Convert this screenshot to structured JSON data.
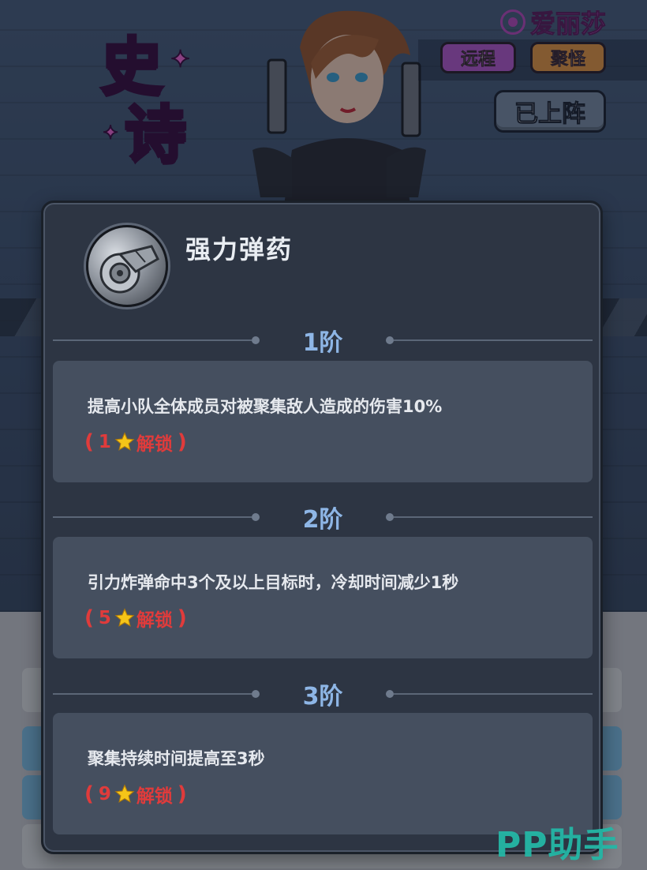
{
  "hero": {
    "rarity_char_1": "史",
    "rarity_char_2": "诗",
    "name": "爱丽莎",
    "tags": [
      "远程",
      "聚怪"
    ],
    "deployed_label": "已上阵"
  },
  "skill": {
    "title": "强力弹药",
    "tiers": [
      {
        "label": "1阶",
        "desc": "提高小队全体成员对被聚集敌人造成的伤害10%",
        "stars": "1",
        "unlock_label": "解锁"
      },
      {
        "label": "2阶",
        "desc": "引力炸弹命中3个及以上目标时，冷却时间减少1秒",
        "stars": "5",
        "unlock_label": "解锁"
      },
      {
        "label": "3阶",
        "desc": "聚集持续时间提高至3秒",
        "stars": "9",
        "unlock_label": "解锁"
      }
    ],
    "paren_open": "(",
    "paren_close": ")"
  },
  "watermark": "PP助手",
  "colors": {
    "rarity_pink": "#e84bd3",
    "tier_label_blue": "#8eb6e6",
    "unlock_red": "#e03b3b",
    "star_gold": "#f5c518",
    "watermark_teal": "#24b7a6"
  },
  "icons": [
    "rarity-swirl-icon",
    "star-icon",
    "skill-ammo-icon",
    "left-arrow-icon",
    "right-arrow-icon"
  ]
}
